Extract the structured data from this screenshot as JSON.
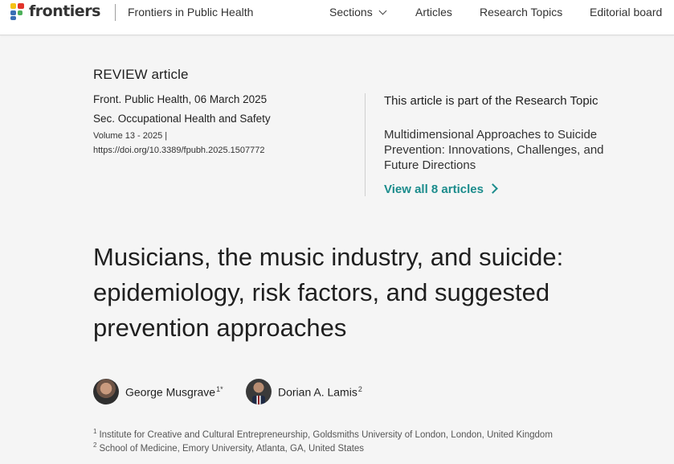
{
  "header": {
    "logo_text": "frontiers",
    "journal_name": "Frontiers in Public Health",
    "nav": {
      "sections": "Sections",
      "articles": "Articles",
      "research_topics": "Research Topics",
      "editorial_board": "Editorial board"
    }
  },
  "article": {
    "type": "REVIEW article",
    "journal_date": "Front. Public Health, 06 March 2025",
    "section": "Sec. Occupational Health and Safety",
    "volume": "Volume 13 - 2025 |",
    "doi": "https://doi.org/10.3389/fpubh.2025.1507772",
    "title": "Musicians, the music industry, and suicide: epidemiology, risk factors, and suggested prevention approaches"
  },
  "research_topic": {
    "heading": "This article is part of the Research Topic",
    "title": "Multidimensional Approaches to Suicide Prevention: Innovations, Challenges, and Future Directions",
    "view_all": "View all 8 articles"
  },
  "authors": [
    {
      "name": "George Musgrave",
      "sup": "1*"
    },
    {
      "name": "Dorian A. Lamis",
      "sup": "2"
    }
  ],
  "affiliations": [
    {
      "num": "1",
      "text": "Institute for Creative and Cultural Entrepreneurship, Goldsmiths University of London, London, United Kingdom"
    },
    {
      "num": "2",
      "text": "School of Medicine, Emory University, Atlanta, GA, United States"
    }
  ],
  "colors": {
    "accent": "#1b8c8c",
    "logo_red": "#e2342b",
    "logo_yellow": "#f5c316",
    "logo_blue": "#3a6fb5",
    "logo_green": "#4db05a"
  }
}
